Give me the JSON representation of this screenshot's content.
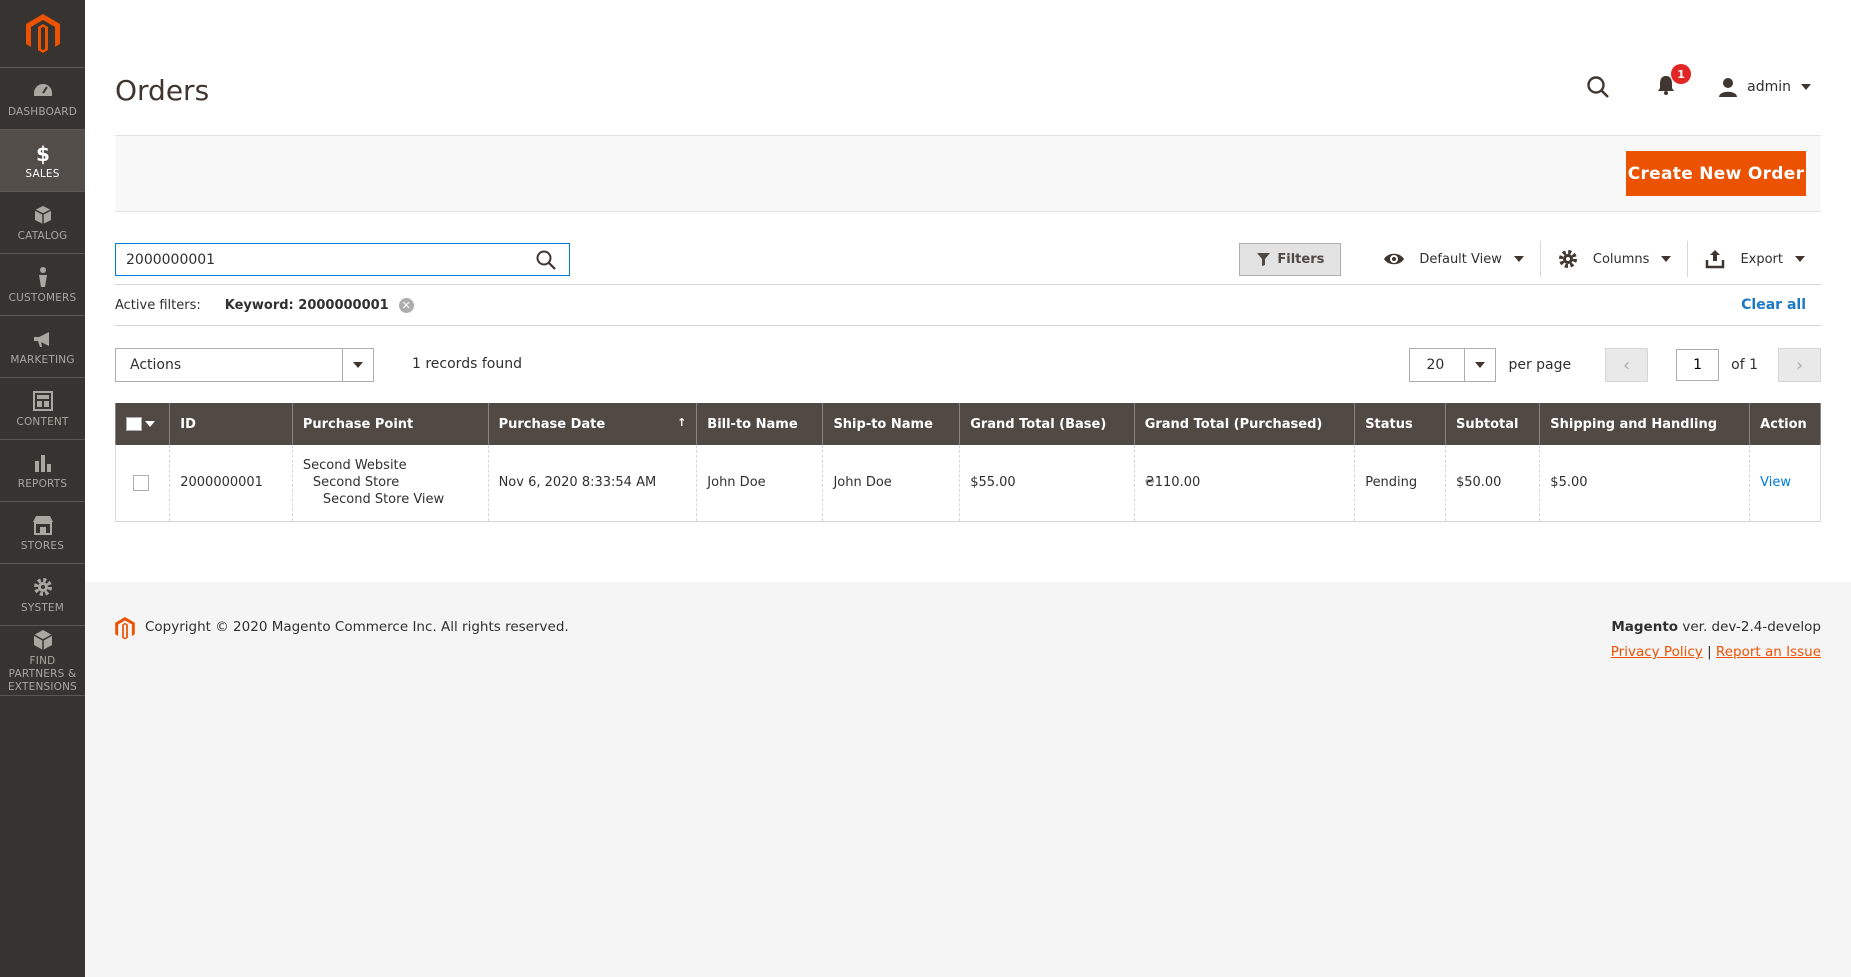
{
  "sidebar": {
    "items": [
      {
        "label": "DASHBOARD"
      },
      {
        "label": "SALES"
      },
      {
        "label": "CATALOG"
      },
      {
        "label": "CUSTOMERS"
      },
      {
        "label": "MARKETING"
      },
      {
        "label": "CONTENT"
      },
      {
        "label": "REPORTS"
      },
      {
        "label": "STORES"
      },
      {
        "label": "SYSTEM"
      },
      {
        "label": "FIND PARTNERS & EXTENSIONS"
      }
    ]
  },
  "header": {
    "title": "Orders",
    "notification_count": "1",
    "user_name": "admin"
  },
  "actions_bar": {
    "create_button": "Create New Order"
  },
  "search": {
    "value": "2000000001"
  },
  "toolbar": {
    "filters": "Filters",
    "default_view": "Default View",
    "columns": "Columns",
    "export": "Export"
  },
  "filters": {
    "label": "Active filters:",
    "chip": "Keyword: 2000000001",
    "clear_all": "Clear all"
  },
  "grid_controls": {
    "actions": "Actions",
    "records_found": "1 records found",
    "per_page_value": "20",
    "per_page_label": "per page",
    "page_value": "1",
    "page_of": "of 1"
  },
  "table": {
    "columns": [
      "ID",
      "Purchase Point",
      "Purchase Date",
      "Bill-to Name",
      "Ship-to Name",
      "Grand Total (Base)",
      "Grand Total (Purchased)",
      "Status",
      "Subtotal",
      "Shipping and Handling",
      "Action"
    ],
    "sort_indicator": "↑",
    "rows": [
      {
        "id": "2000000001",
        "purchase_point": [
          "Second Website",
          "Second Store",
          "Second Store View"
        ],
        "purchase_date": "Nov 6, 2020 8:33:54 AM",
        "bill_to": "John Doe",
        "ship_to": "John Doe",
        "grand_total_base": "$55.00",
        "grand_total_purchased": "₴110.00",
        "status": "Pending",
        "subtotal": "$50.00",
        "shipping": "$5.00",
        "action": "View"
      }
    ]
  },
  "footer": {
    "copyright": "Copyright © 2020 Magento Commerce Inc. All rights reserved.",
    "brand": "Magento",
    "version": " ver. dev-2.4-develop",
    "privacy": "Privacy Policy",
    "separator": "|",
    "report": "Report an Issue"
  },
  "colors": {
    "accent": "#eb5202",
    "sidebar_bg": "#373330",
    "table_header_bg": "#514943",
    "link": "#1979c3"
  }
}
